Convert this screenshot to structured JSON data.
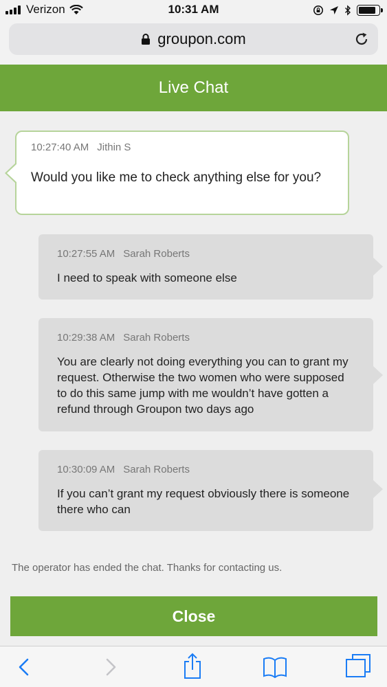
{
  "status_bar": {
    "carrier": "Verizon",
    "time": "10:31 AM",
    "battery_level": 0.85
  },
  "browser": {
    "url": "groupon.com"
  },
  "chat": {
    "title": "Live Chat",
    "messages": [
      {
        "time": "10:27:40 AM",
        "author": "Jithin S",
        "text": "Would you like me to check anything else for you?",
        "from": "agent"
      },
      {
        "time": "10:27:55 AM",
        "author": "Sarah Roberts",
        "text": "I need to speak with someone else",
        "from": "user"
      },
      {
        "time": "10:29:38 AM",
        "author": "Sarah Roberts",
        "text": "You are clearly not doing everything you can to grant my request. Otherwise the two women who were supposed to do this same jump with me wouldn’t have gotten a refund through Groupon two days ago",
        "from": "user"
      },
      {
        "time": "10:30:09 AM",
        "author": "Sarah Roberts",
        "text": "If you can’t grant my request obviously there is someone there who can",
        "from": "user"
      }
    ],
    "ended_note": "The operator has ended the chat. Thanks for contacting us.",
    "close_label": "Close"
  },
  "colors": {
    "accent_green": "#6ea63a",
    "agent_border": "#b6d49a",
    "user_bubble": "#dcdcdc",
    "ios_blue": "#1a7cf5"
  },
  "toolbar": {
    "icons": [
      "back-icon",
      "forward-icon",
      "share-icon",
      "bookmarks-icon",
      "tabs-icon"
    ]
  }
}
